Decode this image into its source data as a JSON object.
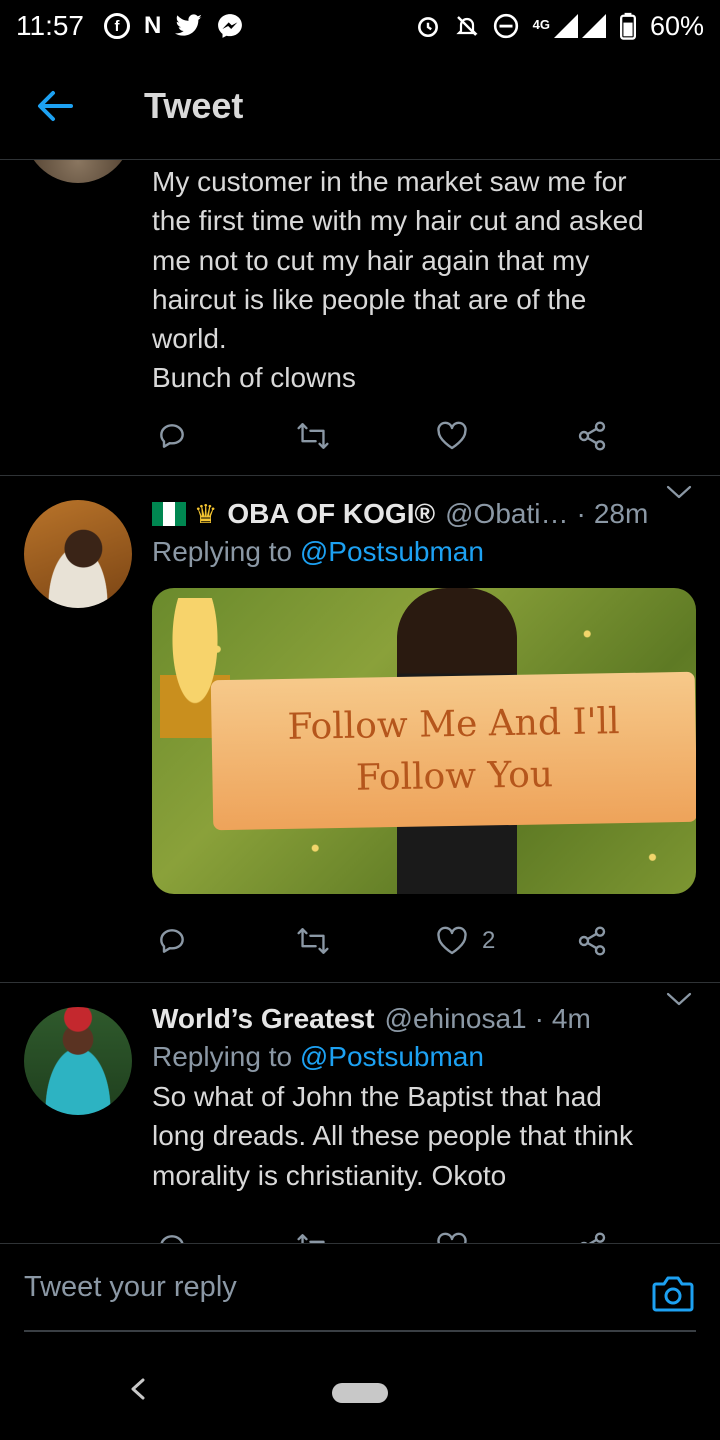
{
  "status_bar": {
    "time": "11:57",
    "battery": "60%",
    "network": "4G",
    "icons_left": [
      "facebook-icon",
      "news-icon",
      "twitter-icon",
      "messenger-icon"
    ],
    "icons_right": [
      "alarm-icon",
      "mute-icon",
      "dnd-icon",
      "signal-icon",
      "battery-icon"
    ]
  },
  "header": {
    "title": "Tweet"
  },
  "tweets": [
    {
      "lines": [
        "My customer in the market saw me for",
        "the first time with my hair cut and asked",
        "me not to cut my hair again that my",
        "haircut is like people that are of the",
        "world.",
        "Bunch of clowns"
      ],
      "like_count": ""
    },
    {
      "name": "OBA OF KOGI®",
      "handle": "@Obati…",
      "time": "28m",
      "replying_prefix": "Replying to",
      "replying_to": "@Postsubman",
      "image_text": [
        "Follow Me And I'll",
        "Follow You"
      ],
      "like_count": "2"
    },
    {
      "name": "World’s Greatest",
      "handle": "@ehinosa1",
      "time": "4m",
      "replying_prefix": "Replying to",
      "replying_to": "@Postsubman",
      "lines": [
        "So what of John the Baptist that had",
        "long dreads. All these people that think",
        "morality is christianity. Okoto"
      ]
    }
  ],
  "reply_bar": {
    "placeholder": "Tweet your reply"
  },
  "colors": {
    "accent": "#1da1f2",
    "background": "#000000",
    "muted": "#8b98a5",
    "divider": "#2f3336"
  }
}
